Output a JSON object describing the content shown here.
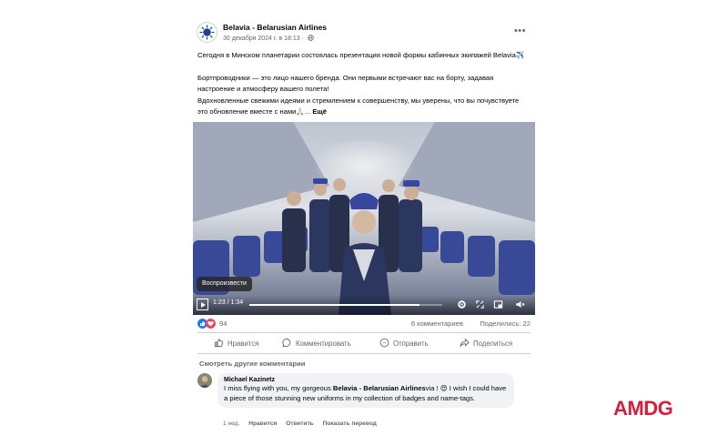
{
  "post": {
    "page_name": "Belavia - Belarusian Airlines",
    "date": "30 декабря 2024 г. в 18:13 ·",
    "more_icon": "more-horizontal-icon",
    "text": [
      "Сегодня в Минском планетарии состоялась презентация новой формы кабинных экипажей Belavia✈️",
      "Бортпроводники — это лицо нашего бренда. Они первыми встречают вас на борту, задавая настроение и атмосферу вашего полета!",
      "Вдохновленные свежими идеями и стремлением к совершенству, мы уверены, что вы почувствуете это обновление вместе с нами🙏🏻..."
    ],
    "see_more": "Ещё"
  },
  "video": {
    "tooltip": "Воспроизвести",
    "time": "1:23 / 1:34",
    "progress": 0.88
  },
  "stats": {
    "reactions_count": "94",
    "comments": "6 комментариев",
    "shares": "Поделились: 22",
    "reaction_icons": [
      "like-icon",
      "love-icon"
    ]
  },
  "actions": {
    "like": "Нравится",
    "comment": "Комментировать",
    "send": "Отправить",
    "share": "Поделиться"
  },
  "comments": {
    "see_others": "Смотреть другие комментарии",
    "items": [
      {
        "author": "Michael Kazinetz",
        "pre": "I miss flying with you, my gorgeous ",
        "mention": "Belavia - Belarusian Airlines",
        "post": "via ! 😍 I wish I could have a piece of those stunning new uniforms in my collection of badges and name-tags.",
        "time": "1 нед.",
        "like": "Нравится",
        "reply": "Ответить",
        "translate": "Показать перевод"
      }
    ]
  },
  "brand": {
    "text": "AMDG",
    "color": "#d51f3a"
  }
}
